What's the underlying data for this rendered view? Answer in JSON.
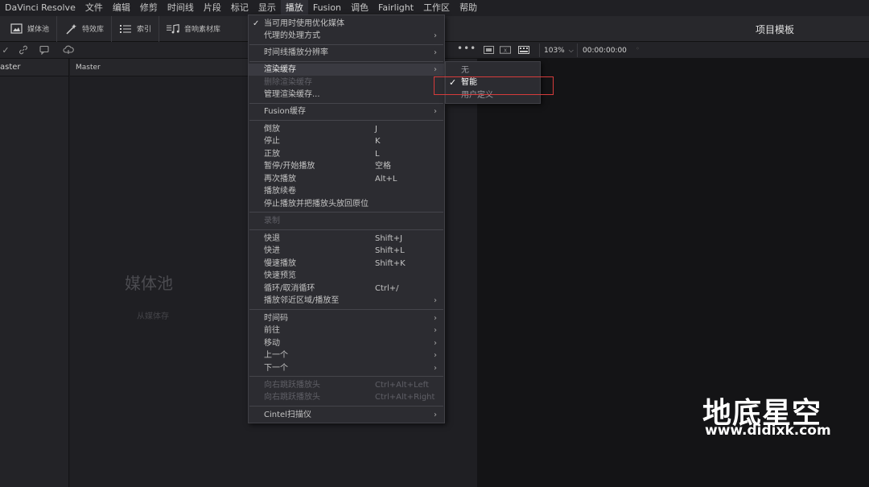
{
  "menubar": {
    "items": [
      "DaVinci Resolve",
      "文件",
      "编辑",
      "修剪",
      "时间线",
      "片段",
      "标记",
      "显示",
      "播放",
      "Fusion",
      "调色",
      "Fairlight",
      "工作区",
      "帮助"
    ],
    "active_index": 8
  },
  "toolbar": {
    "media_pool": "媒体池",
    "effects": "特效库",
    "index": "索引",
    "sound_library": "音响素材库",
    "project_template": "项目模板"
  },
  "viewer_bar": {
    "zoom": "103%",
    "timecode": "00:00:00:00"
  },
  "bins": {
    "left_header": "aster",
    "media_header": "Master",
    "empty_title": "媒体池",
    "empty_sub": "从媒体存"
  },
  "menu": {
    "items": [
      {
        "label": "当可用时使用优化媒体",
        "check": "✓"
      },
      {
        "label": "代理的处理方式",
        "arrow": "›"
      },
      {
        "label": "时间线播放分辨率",
        "arrow": "›"
      },
      {
        "label": "渲染缓存",
        "arrow": "›",
        "highlight": true
      },
      {
        "label": "删除渲染缓存",
        "disabled": true
      },
      {
        "label": "管理渲染缓存..."
      },
      {
        "label": "Fusion缓存",
        "arrow": "›"
      },
      {
        "label": "倒放",
        "shortcut": "J"
      },
      {
        "label": "停止",
        "shortcut": "K"
      },
      {
        "label": "正放",
        "shortcut": "L"
      },
      {
        "label": "暂停/开始播放",
        "shortcut": "空格"
      },
      {
        "label": "再次播放",
        "shortcut": "Alt+L"
      },
      {
        "label": "播放续卷"
      },
      {
        "label": "停止播放并把播放头放回原位"
      },
      {
        "label": "录制",
        "disabled": true
      },
      {
        "label": "快退",
        "shortcut": "Shift+J"
      },
      {
        "label": "快进",
        "shortcut": "Shift+L"
      },
      {
        "label": "慢速播放",
        "shortcut": "Shift+K"
      },
      {
        "label": "快速预览"
      },
      {
        "label": "循环/取消循环",
        "shortcut": "Ctrl+/"
      },
      {
        "label": "播放邻近区域/播放至",
        "arrow": "›"
      },
      {
        "label": "时间码",
        "arrow": "›"
      },
      {
        "label": "前往",
        "arrow": "›"
      },
      {
        "label": "移动",
        "arrow": "›"
      },
      {
        "label": "上一个",
        "arrow": "›"
      },
      {
        "label": "下一个",
        "arrow": "›"
      },
      {
        "label": "向右跳跃播放头",
        "shortcut": "Ctrl+Alt+Left",
        "disabled": true
      },
      {
        "label": "向右跳跃播放头",
        "shortcut": "Ctrl+Alt+Right",
        "disabled": true
      },
      {
        "label": "Cintel扫描仪",
        "arrow": "›"
      }
    ]
  },
  "submenu": {
    "items": [
      {
        "label": "无"
      },
      {
        "label": "智能",
        "check": "✓",
        "selected": true
      },
      {
        "label": "用户定义"
      }
    ]
  },
  "watermark": {
    "title": "地底星空",
    "url": "www.didixk.com"
  },
  "colors": {
    "highlight_box": "#d63b3b",
    "menu_bg": "#2c2c31",
    "app_bg": "#1c1c1f"
  }
}
